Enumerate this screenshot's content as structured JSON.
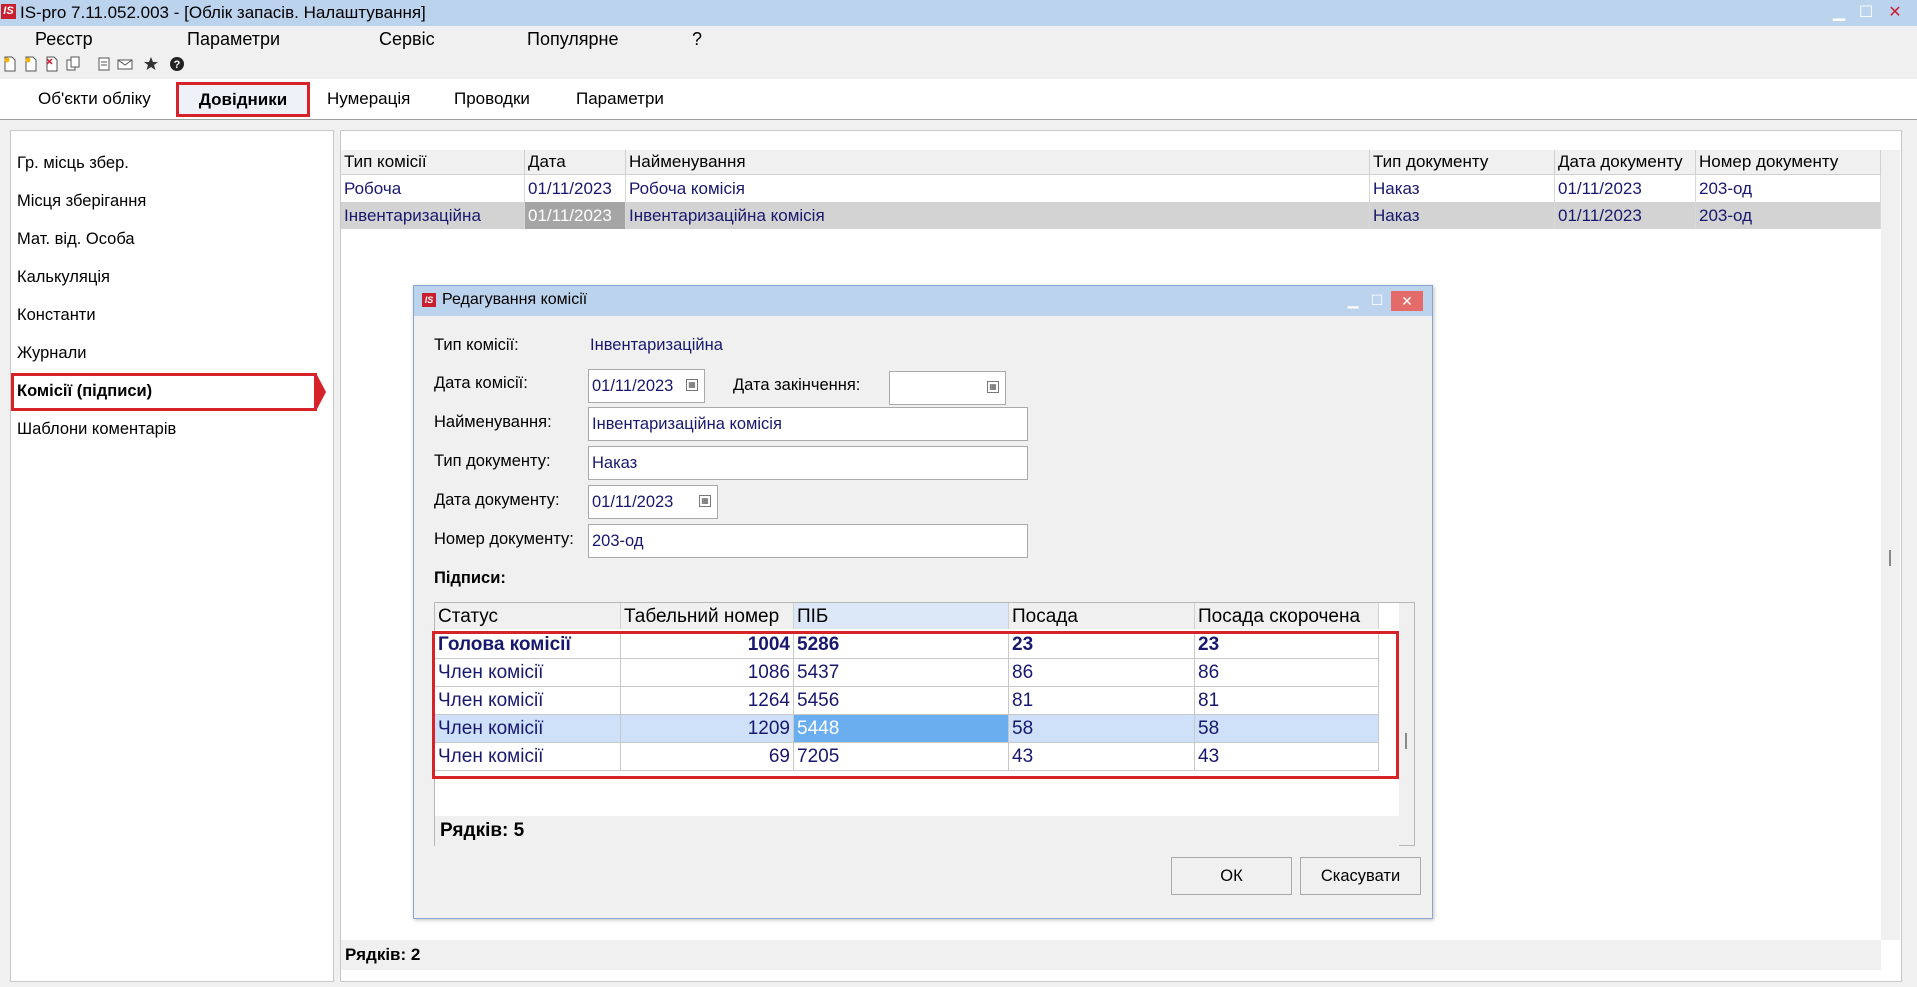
{
  "window": {
    "logo": "IS",
    "title": "IS-pro 7.11.052.003 - [Облік запасів. Налаштування]",
    "controls": {
      "minimize": "▁",
      "maximize": "☐",
      "close": "✕"
    }
  },
  "menu": [
    "Реєстр",
    "Параметри",
    "Сервіс",
    "Популярне",
    "?"
  ],
  "toolbar_icons": [
    "new-doc-icon",
    "new-doc-icon",
    "delete-icon",
    "copy-icon",
    "view-icon",
    "mail-icon",
    "favorite-icon",
    "help-icon"
  ],
  "tabs": [
    "Об'єкти обліку",
    "Довідники",
    "Нумерація",
    "Проводки",
    "Параметри"
  ],
  "sidebar": [
    "Гр. місць збер.",
    "Місця зберігання",
    "Мат. від. Особа",
    "Калькуляція",
    "Константи",
    "Журнали",
    "Комісії (підписи)",
    "Шаблони коментарів"
  ],
  "main_grid": {
    "headers": [
      "Тип комісії",
      "Дата",
      "Найменування",
      "Тип документу",
      "Дата документу",
      "Номер документу"
    ],
    "rows": [
      [
        "Робоча",
        "01/11/2023",
        "Робоча  комісія",
        "Наказ",
        "01/11/2023",
        "203-од"
      ],
      [
        "Інвентаризаційна",
        "01/11/2023",
        "Інвентаризаційна  комісія",
        "Наказ",
        "01/11/2023",
        "203-од"
      ]
    ],
    "footer": "Рядків: 2"
  },
  "dialog": {
    "logo": "IS",
    "title": "Редагування комісії",
    "labels": {
      "type": "Тип комісії:",
      "date": "Дата комісії:",
      "end_date": "Дата закінчення:",
      "name": "Найменування:",
      "doc_type": "Тип документу:",
      "doc_date": "Дата документу:",
      "doc_number": "Номер документу:",
      "signatures": "Підписи:"
    },
    "values": {
      "type": "Інвентаризаційна",
      "date": "01/11/2023",
      "end_date": "",
      "name": "Інвентаризаційна  комісія",
      "doc_type": "Наказ",
      "doc_date": "01/11/2023",
      "doc_number": "203-од"
    },
    "signatures": {
      "headers": [
        "Статус",
        "Табельний номер",
        "ПІБ",
        "Посада",
        "Посада скорочена"
      ],
      "rows": [
        [
          "Голова комісії",
          "1004",
          "5286",
          "23",
          "23"
        ],
        [
          "Член комісії",
          "1086",
          "5437",
          "86",
          "86"
        ],
        [
          "Член комісії",
          "1264",
          "5456",
          "81",
          "81"
        ],
        [
          "Член комісії",
          "1209",
          "5448",
          "58",
          "58"
        ],
        [
          "Член комісії",
          "69",
          "7205",
          "43",
          "43"
        ]
      ],
      "footer": "Рядків: 5"
    },
    "buttons": {
      "ok": "ОК",
      "cancel": "Скасувати"
    }
  },
  "colors": {
    "titlebar": "#bcd3ee",
    "highlight_border": "#d6232a",
    "text_value": "#18186e",
    "row_selected": "#d3d3d3",
    "sig_row_selected": "#cfe1f8",
    "sig_cell_selected": "#6aaeef"
  }
}
